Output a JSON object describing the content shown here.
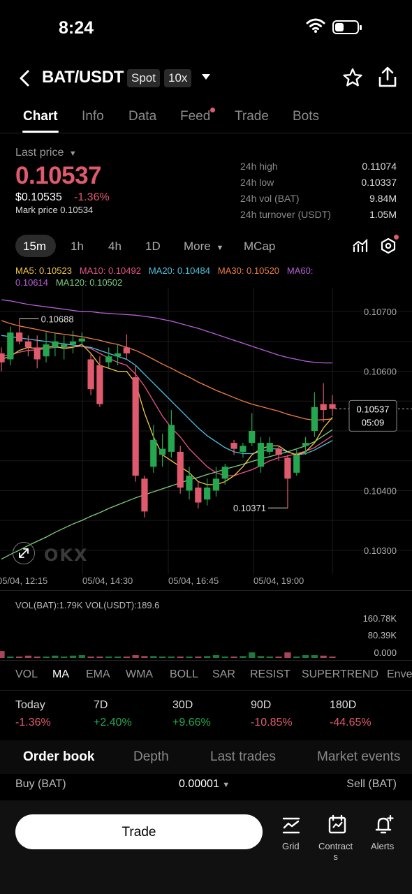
{
  "status": {
    "time": "8:24"
  },
  "header": {
    "pair": "BAT/USDT",
    "spot": "Spot",
    "leverage": "10x"
  },
  "tabs": [
    "Chart",
    "Info",
    "Data",
    "Feed",
    "Trade",
    "Bots"
  ],
  "price": {
    "label": "Last price",
    "value": "0.10537",
    "usd": "$0.10535",
    "change": "-1.36%",
    "mark": "Mark price 0.10534"
  },
  "stats": [
    {
      "label": "24h high",
      "value": "0.11074"
    },
    {
      "label": "24h low",
      "value": "0.10337"
    },
    {
      "label": "24h vol (BAT)",
      "value": "9.84M"
    },
    {
      "label": "24h turnover (USDT)",
      "value": "1.05M"
    }
  ],
  "timeframes": [
    "15m",
    "1h",
    "4h",
    "1D",
    "More",
    "MCap"
  ],
  "ma_labels": {
    "ma5": "MA5: 0.10523",
    "ma10": "MA10: 0.10492",
    "ma20": "MA20: 0.10484",
    "ma30": "MA30: 0.10520",
    "ma60": "MA60:",
    "ma60_val": "0.10614",
    "ma120": "MA120: 0.10502"
  },
  "colors": {
    "up": "#25a750",
    "down": "#e05a6e",
    "ma5": "#f5c842",
    "ma10": "#e8558a",
    "ma20": "#4ec3e0",
    "ma30": "#ef7e45",
    "ma60": "#b65fd8",
    "ma120": "#7ecf7e"
  },
  "chart_axis": {
    "y_ticks": [
      "0.10700",
      "0.10600",
      "0.10400",
      "0.10300"
    ],
    "current_price": "0.10537",
    "countdown": "05:09",
    "high_marker": "0.10688",
    "low_marker": "0.10371",
    "x_ticks": [
      "05/04, 12:15",
      "05/04, 14:30",
      "05/04, 16:45",
      "05/04, 19:00"
    ],
    "watermark": "OKX"
  },
  "chart_data": {
    "type": "candlestick",
    "ylim": [
      0.1026,
      0.1074
    ],
    "candles": [
      {
        "o": 0.1063,
        "c": 0.10615,
        "h": 0.1064,
        "l": 0.106
      },
      {
        "o": 0.1062,
        "c": 0.10665,
        "h": 0.10675,
        "l": 0.1061
      },
      {
        "o": 0.10665,
        "c": 0.1065,
        "h": 0.10688,
        "l": 0.10645
      },
      {
        "o": 0.1065,
        "c": 0.1064,
        "h": 0.1066,
        "l": 0.10625
      },
      {
        "o": 0.1064,
        "c": 0.1062,
        "h": 0.1066,
        "l": 0.10605
      },
      {
        "o": 0.10625,
        "c": 0.10645,
        "h": 0.10665,
        "l": 0.10615
      },
      {
        "o": 0.1064,
        "c": 0.1065,
        "h": 0.10665,
        "l": 0.10625
      },
      {
        "o": 0.1064,
        "c": 0.10645,
        "h": 0.1066,
        "l": 0.1062
      },
      {
        "o": 0.10645,
        "c": 0.1065,
        "h": 0.10668,
        "l": 0.1063
      },
      {
        "o": 0.1065,
        "c": 0.10655,
        "h": 0.10665,
        "l": 0.1064
      },
      {
        "o": 0.1062,
        "c": 0.1057,
        "h": 0.1063,
        "l": 0.1056
      },
      {
        "o": 0.1061,
        "c": 0.10545,
        "h": 0.10625,
        "l": 0.1054
      },
      {
        "o": 0.10615,
        "c": 0.10625,
        "h": 0.1064,
        "l": 0.10605
      },
      {
        "o": 0.10625,
        "c": 0.1063,
        "h": 0.10645,
        "l": 0.1061
      },
      {
        "o": 0.1064,
        "c": 0.1063,
        "h": 0.10662,
        "l": 0.1062
      },
      {
        "o": 0.1059,
        "c": 0.10425,
        "h": 0.1061,
        "l": 0.10415
      },
      {
        "o": 0.1042,
        "c": 0.10365,
        "h": 0.10425,
        "l": 0.10355
      },
      {
        "o": 0.1044,
        "c": 0.10485,
        "h": 0.1051,
        "l": 0.1043
      },
      {
        "o": 0.1046,
        "c": 0.1047,
        "h": 0.10495,
        "l": 0.1044
      },
      {
        "o": 0.10465,
        "c": 0.1051,
        "h": 0.10535,
        "l": 0.10455
      },
      {
        "o": 0.10465,
        "c": 0.10405,
        "h": 0.10475,
        "l": 0.10395
      },
      {
        "o": 0.104,
        "c": 0.10425,
        "h": 0.1044,
        "l": 0.10385
      },
      {
        "o": 0.10405,
        "c": 0.1038,
        "h": 0.10415,
        "l": 0.1037
      },
      {
        "o": 0.10385,
        "c": 0.10405,
        "h": 0.1042,
        "l": 0.10375
      },
      {
        "o": 0.104,
        "c": 0.1042,
        "h": 0.1044,
        "l": 0.1039
      },
      {
        "o": 0.1042,
        "c": 0.1044,
        "h": 0.10445,
        "l": 0.1041
      },
      {
        "o": 0.1048,
        "c": 0.1047,
        "h": 0.10485,
        "l": 0.1046
      },
      {
        "o": 0.10465,
        "c": 0.10475,
        "h": 0.1048,
        "l": 0.10455
      },
      {
        "o": 0.1048,
        "c": 0.105,
        "h": 0.1053,
        "l": 0.10475
      },
      {
        "o": 0.1044,
        "c": 0.1048,
        "h": 0.1049,
        "l": 0.1043
      },
      {
        "o": 0.10465,
        "c": 0.1048,
        "h": 0.1049,
        "l": 0.1046
      },
      {
        "o": 0.1047,
        "c": 0.1046,
        "h": 0.10475,
        "l": 0.1045
      },
      {
        "o": 0.10455,
        "c": 0.1042,
        "h": 0.1046,
        "l": 0.10371
      },
      {
        "o": 0.1043,
        "c": 0.1046,
        "h": 0.1047,
        "l": 0.10425
      },
      {
        "o": 0.10475,
        "c": 0.1048,
        "h": 0.1049,
        "l": 0.1046
      },
      {
        "o": 0.105,
        "c": 0.1054,
        "h": 0.10565,
        "l": 0.1049
      },
      {
        "o": 0.10545,
        "c": 0.10535,
        "h": 0.1058,
        "l": 0.10515
      },
      {
        "o": 0.10545,
        "c": 0.10537,
        "h": 0.1056,
        "l": 0.10525
      }
    ],
    "ma5": [
      0.1062,
      0.10625,
      0.10635,
      0.1064,
      0.10638,
      0.1064,
      0.10642,
      0.10638,
      0.1064,
      0.10645,
      0.1063,
      0.1061,
      0.10605,
      0.106,
      0.106,
      0.1058,
      0.1053,
      0.1049,
      0.1046,
      0.1045,
      0.1044,
      0.1043,
      0.10415,
      0.1041,
      0.1041,
      0.10415,
      0.10425,
      0.1044,
      0.1046,
      0.1047,
      0.10475,
      0.10475,
      0.10465,
      0.1046,
      0.10465,
      0.1048,
      0.10505,
      0.10523
    ],
    "ma10": [
      0.10625,
      0.10628,
      0.10632,
      0.10635,
      0.10636,
      0.10638,
      0.1064,
      0.1064,
      0.10641,
      0.10642,
      0.10638,
      0.1063,
      0.10622,
      0.10615,
      0.1061,
      0.10595,
      0.10575,
      0.1055,
      0.10525,
      0.10505,
      0.1049,
      0.1047,
      0.10455,
      0.1044,
      0.1043,
      0.10425,
      0.10425,
      0.1043,
      0.10435,
      0.10442,
      0.1045,
      0.10455,
      0.10458,
      0.10462,
      0.10466,
      0.10472,
      0.10482,
      0.10492
    ],
    "ma20": [
      0.1066,
      0.10658,
      0.10656,
      0.10654,
      0.10652,
      0.1065,
      0.10648,
      0.10646,
      0.10644,
      0.10642,
      0.1064,
      0.10635,
      0.1063,
      0.10625,
      0.1062,
      0.1061,
      0.10595,
      0.1058,
      0.10565,
      0.1055,
      0.10535,
      0.1052,
      0.10505,
      0.10492,
      0.10482,
      0.10472,
      0.10465,
      0.10462,
      0.10462,
      0.10465,
      0.1047,
      0.1047,
      0.10465,
      0.1046,
      0.10462,
      0.10468,
      0.10476,
      0.10484
    ],
    "ma30": [
      0.10685,
      0.1068,
      0.10676,
      0.10673,
      0.1067,
      0.10667,
      0.10664,
      0.10662,
      0.1066,
      0.10658,
      0.10655,
      0.10652,
      0.10648,
      0.10645,
      0.1064,
      0.10635,
      0.10628,
      0.1062,
      0.10612,
      0.10605,
      0.10597,
      0.1059,
      0.10582,
      0.10575,
      0.10568,
      0.10562,
      0.10556,
      0.1055,
      0.10545,
      0.10541,
      0.10537,
      0.10533,
      0.10528,
      0.10524,
      0.1052,
      0.10518,
      0.10519,
      0.1052
    ],
    "ma60": [
      0.1072,
      0.10718,
      0.10715,
      0.10712,
      0.1071,
      0.10708,
      0.10706,
      0.10704,
      0.10702,
      0.107,
      0.107,
      0.10698,
      0.10697,
      0.10696,
      0.10695,
      0.10694,
      0.10692,
      0.1069,
      0.10687,
      0.10684,
      0.1068,
      0.10676,
      0.10672,
      0.10667,
      0.10662,
      0.10657,
      0.10652,
      0.10647,
      0.10642,
      0.10637,
      0.10632,
      0.10627,
      0.10623,
      0.1062,
      0.10617,
      0.10615,
      0.10614,
      0.10614
    ],
    "ma120": [
      0.10285,
      0.10293,
      0.103,
      0.10308,
      0.10315,
      0.10322,
      0.1033,
      0.10337,
      0.10344,
      0.1035,
      0.10357,
      0.10363,
      0.1037,
      0.10376,
      0.10382,
      0.10388,
      0.10393,
      0.10398,
      0.10403,
      0.10408,
      0.10413,
      0.10418,
      0.10422,
      0.10427,
      0.10431,
      0.10436,
      0.1044,
      0.10444,
      0.10449,
      0.10453,
      0.10457,
      0.10461,
      0.10465,
      0.1047,
      0.10475,
      0.10482,
      0.10492,
      0.10502
    ],
    "volume": [
      0.15,
      0.02,
      0.02,
      0.05,
      0.03,
      0.02,
      0.05,
      0.02,
      0.05,
      0.06,
      0.02,
      0.02,
      0.03,
      0.02,
      0.02,
      0.06,
      0.04,
      0.04,
      0.03,
      0.02,
      0.03,
      0.03,
      0.02,
      0.04,
      0.06,
      0.02,
      0.02,
      0.04,
      0.12,
      0.04,
      0.03,
      0.03,
      0.12,
      0.03,
      0.06,
      0.06,
      0.05,
      0.01
    ]
  },
  "volume": {
    "text": "VOL(BAT):1.79K  VOL(USDT):189.6",
    "ticks": [
      "160.78K",
      "80.39K",
      "0.000"
    ]
  },
  "indicators": [
    "VOL",
    "MA",
    "EMA",
    "WMA",
    "BOLL",
    "SAR",
    "RESIST",
    "SUPERTREND",
    "Enve"
  ],
  "performance": [
    {
      "label": "Today",
      "value": "-1.36%",
      "dir": "down"
    },
    {
      "label": "7D",
      "value": "+2.40%",
      "dir": "up"
    },
    {
      "label": "30D",
      "value": "+9.66%",
      "dir": "up"
    },
    {
      "label": "90D",
      "value": "-10.85%",
      "dir": "down"
    },
    {
      "label": "180D",
      "value": "-44.65%",
      "dir": "down"
    }
  ],
  "orderbook": {
    "tabs": [
      "Order book",
      "Depth",
      "Last trades",
      "Market events"
    ],
    "buy": "Buy (BAT)",
    "step": "0.00001",
    "sell": "Sell (BAT)"
  },
  "bottom": {
    "trade": "Trade",
    "grid": "Grid",
    "contracts_1": "Contract",
    "contracts_2": "s",
    "alerts": "Alerts"
  }
}
